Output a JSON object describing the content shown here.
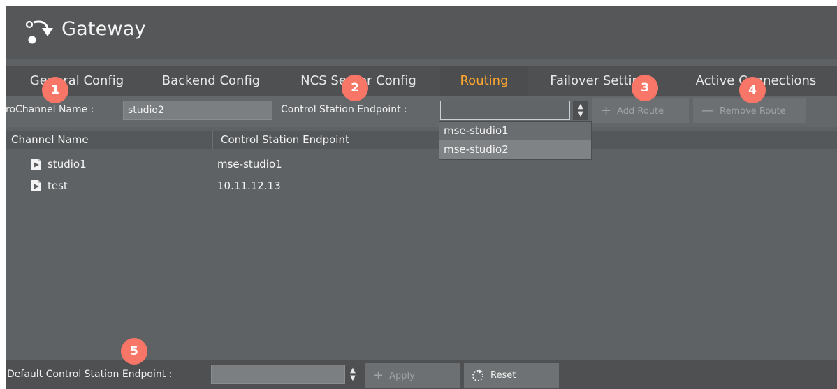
{
  "app": {
    "title": "Gateway",
    "logo_icon": "gateway-arrow-icon"
  },
  "tabs": [
    {
      "label": "General Config",
      "active": false
    },
    {
      "label": "Backend Config",
      "active": false
    },
    {
      "label": "NCS Server Config",
      "active": false
    },
    {
      "label": "Routing",
      "active": true
    },
    {
      "label": "Failover Settings",
      "active": false
    },
    {
      "label": "Active Connections",
      "active": false
    }
  ],
  "toolbar": {
    "channel_label": "roChannel Name :",
    "channel_value": "studio2",
    "endpoint_label": "Control Station Endpoint :",
    "endpoint_value": "",
    "add_route": "Add Route",
    "remove_route": "Remove Route",
    "spin_up": "▲",
    "spin_down": "▼",
    "add_icon": "+",
    "remove_icon": "—"
  },
  "dropdown": {
    "options": [
      "mse-studio1",
      "mse-studio2"
    ],
    "highlighted": "mse-studio2"
  },
  "table": {
    "columns": [
      "Channel Name",
      "Control Station Endpoint"
    ],
    "rows": [
      {
        "name": "studio1",
        "endpoint": "mse-studio1"
      },
      {
        "name": "test",
        "endpoint": "10.11.12.13"
      }
    ]
  },
  "bottom": {
    "default_label": "Default Control Station Endpoint :",
    "default_value": "",
    "apply": "Apply",
    "reset": "Reset",
    "apply_icon": "+"
  },
  "markers": [
    "1",
    "2",
    "3",
    "4",
    "5"
  ],
  "colors": {
    "accent": "#ffa62e",
    "marker": "#f87667",
    "panel": "#5f6264"
  }
}
